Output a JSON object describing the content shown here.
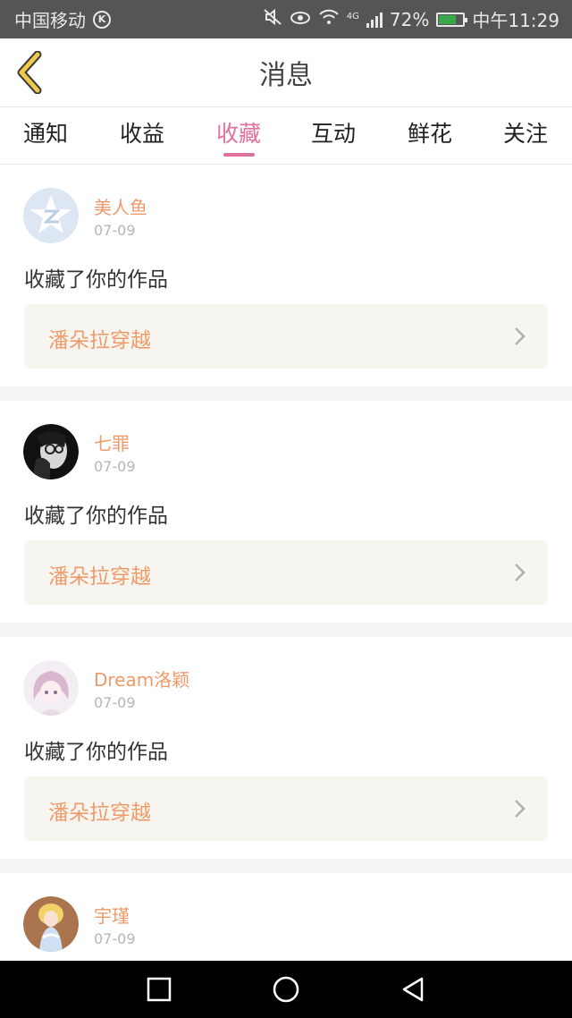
{
  "status_bar": {
    "carrier": "中国移动",
    "carrier_badge": "K",
    "network": "4G",
    "battery": "72%",
    "battery_level": 0.72,
    "time": "中午11:29"
  },
  "header": {
    "title": "消息"
  },
  "tabs": [
    {
      "label": "通知",
      "active": false
    },
    {
      "label": "收益",
      "active": false
    },
    {
      "label": "收藏",
      "active": true
    },
    {
      "label": "互动",
      "active": false
    },
    {
      "label": "鲜花",
      "active": false
    },
    {
      "label": "关注",
      "active": false
    }
  ],
  "messages": [
    {
      "user": "美人鱼",
      "date": "07-09",
      "action": "收藏了你的作品",
      "work": "潘朵拉穿越",
      "avatar": "default-star-avatar"
    },
    {
      "user": "七罪",
      "date": "07-09",
      "action": "收藏了你的作品",
      "work": "潘朵拉穿越",
      "avatar": "dark-photo-avatar"
    },
    {
      "user": "Dream洛颖",
      "date": "07-09",
      "action": "收藏了你的作品",
      "work": "潘朵拉穿越",
      "avatar": "anime-girl-avatar"
    },
    {
      "user": "宇瑾",
      "date": "07-09",
      "action": "",
      "work": "",
      "avatar": "doll-avatar"
    }
  ],
  "colors": {
    "accent_pink": "#e0709c",
    "username_orange": "#ef9a6a",
    "work_box_bg": "#f6f5ef",
    "back_arrow_yellow": "#f0c84a"
  }
}
